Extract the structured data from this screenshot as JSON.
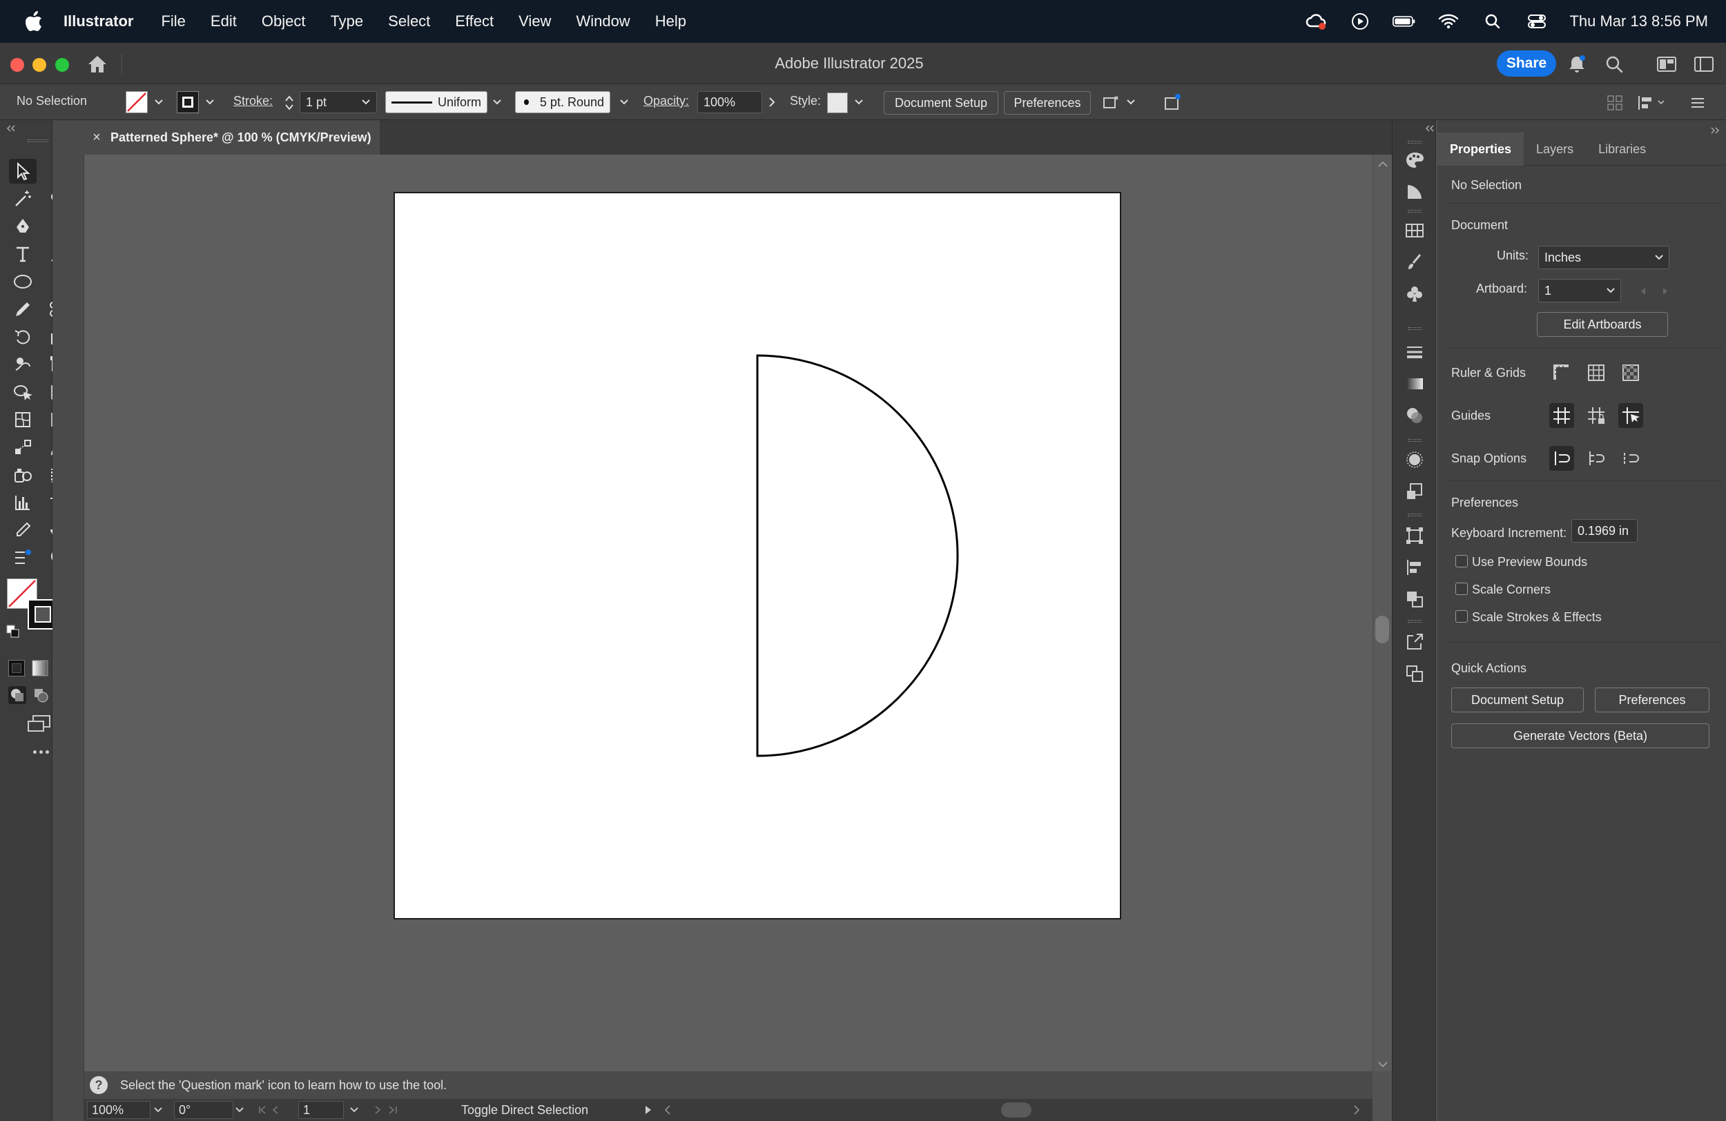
{
  "menubar": {
    "app": "Illustrator",
    "items": [
      "File",
      "Edit",
      "Object",
      "Type",
      "Select",
      "Effect",
      "View",
      "Window",
      "Help"
    ],
    "clock": "Thu Mar 13  8:56 PM"
  },
  "titlebar": {
    "title": "Adobe Illustrator 2025",
    "share_label": "Share"
  },
  "controlbar": {
    "selection": "No Selection",
    "stroke_label": "Stroke:",
    "stroke_value": "1 pt",
    "profile": "Uniform",
    "brush": "5 pt. Round",
    "opacity_label": "Opacity:",
    "opacity_value": "100%",
    "style_label": "Style:",
    "document_setup": "Document Setup",
    "preferences": "Preferences"
  },
  "document": {
    "tab_title": "Patterned Sphere* @ 100 % (CMYK/Preview)",
    "close_glyph": "×"
  },
  "status": {
    "hint": "Select the 'Question mark' icon to learn how to use the tool.",
    "zoom": "100%",
    "rotation": "0°",
    "artboard": "1",
    "tool_label": "Toggle Direct Selection"
  },
  "properties": {
    "tabs": [
      "Properties",
      "Layers",
      "Libraries"
    ],
    "active_tab": "Properties",
    "selection": "No Selection",
    "document_heading": "Document",
    "units_label": "Units:",
    "units_value": "Inches",
    "artboard_label": "Artboard:",
    "artboard_value": "1",
    "edit_artboards": "Edit Artboards",
    "ruler_grids": "Ruler & Grids",
    "guides": "Guides",
    "snap_options": "Snap Options",
    "preferences_heading": "Preferences",
    "keyboard_increment_label": "Keyboard Increment:",
    "keyboard_increment_value": "0.1969 in",
    "checkboxes": [
      {
        "label": "Use Preview Bounds",
        "checked": false
      },
      {
        "label": "Scale Corners",
        "checked": false
      },
      {
        "label": "Scale Strokes & Effects",
        "checked": false
      }
    ],
    "quick_actions_heading": "Quick Actions",
    "qa_document_setup": "Document Setup",
    "qa_preferences": "Preferences",
    "qa_generate_vectors": "Generate Vectors (Beta)"
  },
  "colors": {
    "accent": "#1473e6",
    "artboard": "#ffffff",
    "canvas": "#5e5e5e"
  }
}
